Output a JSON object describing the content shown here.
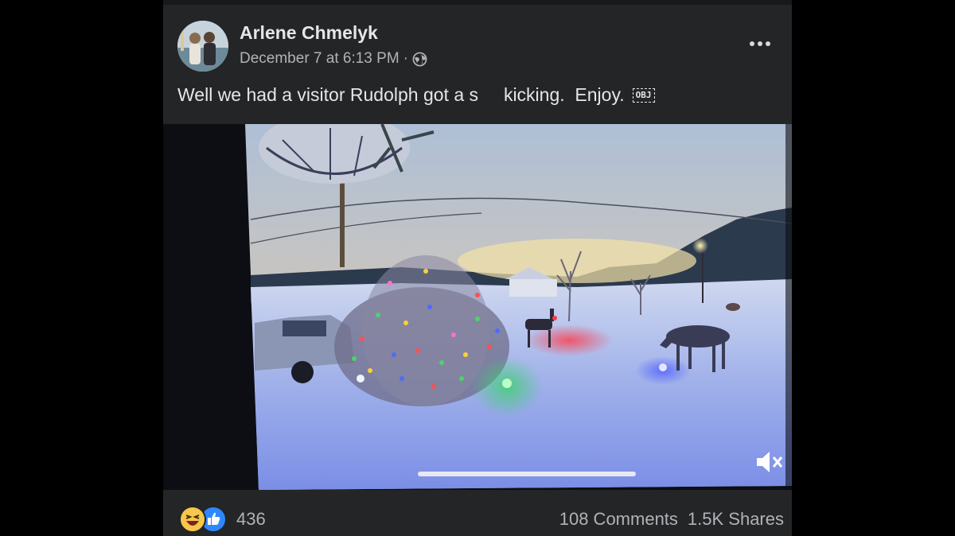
{
  "post": {
    "author": "Arlene Chmelyk",
    "date": "December 7 at 6:13 PM",
    "separator": "·",
    "privacy_icon": "globe-icon",
    "more_icon": "more-options-icon",
    "caption": "Well we had a visitor Rudolph got a s     kicking.  Enjoy.",
    "caption_badge": "OBJ"
  },
  "video": {
    "description_icon": "video-player",
    "progress": 0.35,
    "mute_icon": "volume-muted-icon"
  },
  "footer": {
    "reaction_icons": [
      "haha-reaction-icon",
      "like-reaction-icon"
    ],
    "reaction_count": "436",
    "comments": "108 Comments",
    "shares": "1.5K Shares"
  },
  "colors": {
    "background": "#000000",
    "card": "#242526",
    "text_primary": "#e4e6eb",
    "text_secondary": "#b0b3b8",
    "like_blue": "#2d88ff",
    "haha_yellow": "#f7c64a"
  }
}
